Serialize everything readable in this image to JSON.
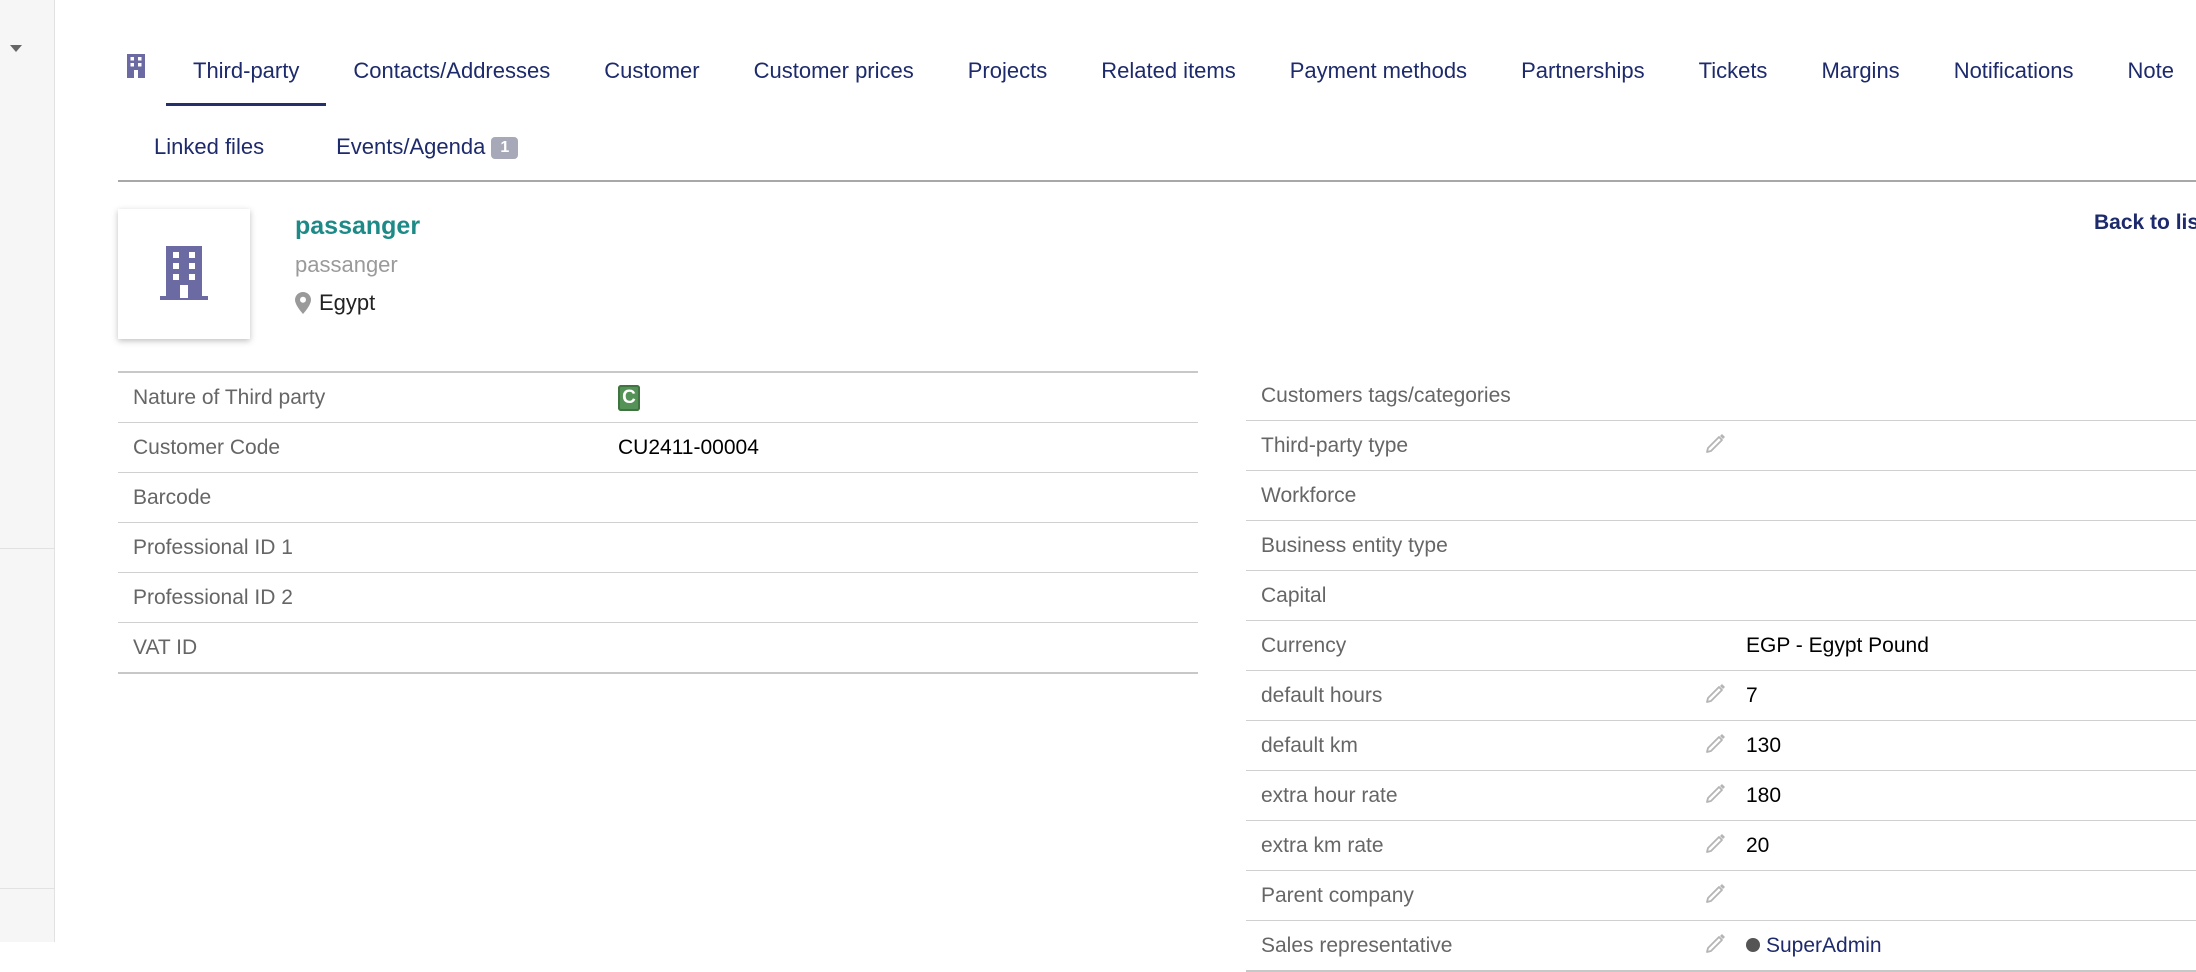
{
  "tabs_row1": [
    {
      "label": "Third-party",
      "active": true
    },
    {
      "label": "Contacts/Addresses"
    },
    {
      "label": "Customer"
    },
    {
      "label": "Customer prices"
    },
    {
      "label": "Projects"
    },
    {
      "label": "Related items"
    },
    {
      "label": "Payment methods"
    },
    {
      "label": "Partnerships"
    },
    {
      "label": "Tickets"
    },
    {
      "label": "Margins"
    },
    {
      "label": "Notifications"
    },
    {
      "label": "Note"
    }
  ],
  "tabs_row2": [
    {
      "label": "Linked files"
    },
    {
      "label": "Events/Agenda",
      "badge": "1"
    }
  ],
  "header": {
    "name": "passanger",
    "alias": "passanger",
    "country": "Egypt",
    "back_link": "Back to lis"
  },
  "left_fields": [
    {
      "label": "Nature of Third party",
      "tag": "C"
    },
    {
      "label": "Customer Code",
      "value": "CU2411-00004"
    },
    {
      "label": "Barcode",
      "value": ""
    },
    {
      "label": "Professional ID 1",
      "value": ""
    },
    {
      "label": "Professional ID 2",
      "value": ""
    },
    {
      "label": "VAT ID",
      "value": ""
    }
  ],
  "right_fields": [
    {
      "label": "Customers tags/categories",
      "value": "",
      "editable": false
    },
    {
      "label": "Third-party type",
      "value": "",
      "editable": true
    },
    {
      "label": "Workforce",
      "value": "",
      "editable": false
    },
    {
      "label": "Business entity type",
      "value": "",
      "editable": false
    },
    {
      "label": "Capital",
      "value": "",
      "editable": false
    },
    {
      "label": "Currency",
      "value": "EGP - Egypt Pound",
      "editable": false
    },
    {
      "label": "default hours",
      "value": "7",
      "editable": true
    },
    {
      "label": "default km",
      "value": "130",
      "editable": true
    },
    {
      "label": "extra hour rate",
      "value": "180",
      "editable": true
    },
    {
      "label": "extra km rate",
      "value": "20",
      "editable": true
    },
    {
      "label": "Parent company",
      "value": "",
      "editable": true
    },
    {
      "label": "Sales representative",
      "value": "SuperAdmin",
      "editable": true
    }
  ],
  "colors": {
    "accent": "#1d2a6b",
    "title": "#1e8a87",
    "icon": "#6b6aa3",
    "tag_green": "#559257"
  },
  "icons": {
    "tab_icon": "building-icon",
    "logo": "building-icon",
    "location": "map-pin-icon",
    "edit": "pencil-icon",
    "user": "user-icon"
  }
}
